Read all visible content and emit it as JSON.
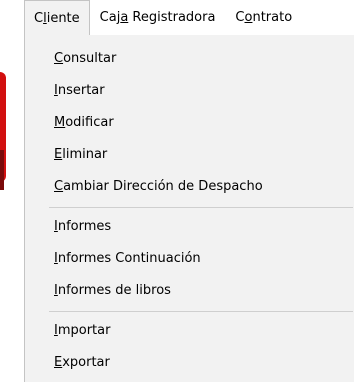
{
  "menubar": {
    "items": [
      {
        "pre": "C",
        "key": "l",
        "post": "iente"
      },
      {
        "pre": "Caj",
        "key": "a",
        "post": " Registradora"
      },
      {
        "pre": "C",
        "key": "o",
        "post": "ntrato"
      }
    ]
  },
  "menu": {
    "items": [
      {
        "key": "C",
        "rest": "onsultar"
      },
      {
        "key": "I",
        "rest": "nsertar"
      },
      {
        "key": "M",
        "rest": "odificar"
      },
      {
        "key": "E",
        "rest": "liminar"
      },
      {
        "key": "C",
        "rest": "ambiar Dirección de Despacho"
      },
      {
        "key": "I",
        "rest": "nformes"
      },
      {
        "key": "I",
        "rest": "nformes Continuación"
      },
      {
        "key": "I",
        "rest": "nformes de libros"
      },
      {
        "key": "I",
        "rest": "mportar"
      },
      {
        "key": "E",
        "rest": "xportar"
      }
    ]
  }
}
